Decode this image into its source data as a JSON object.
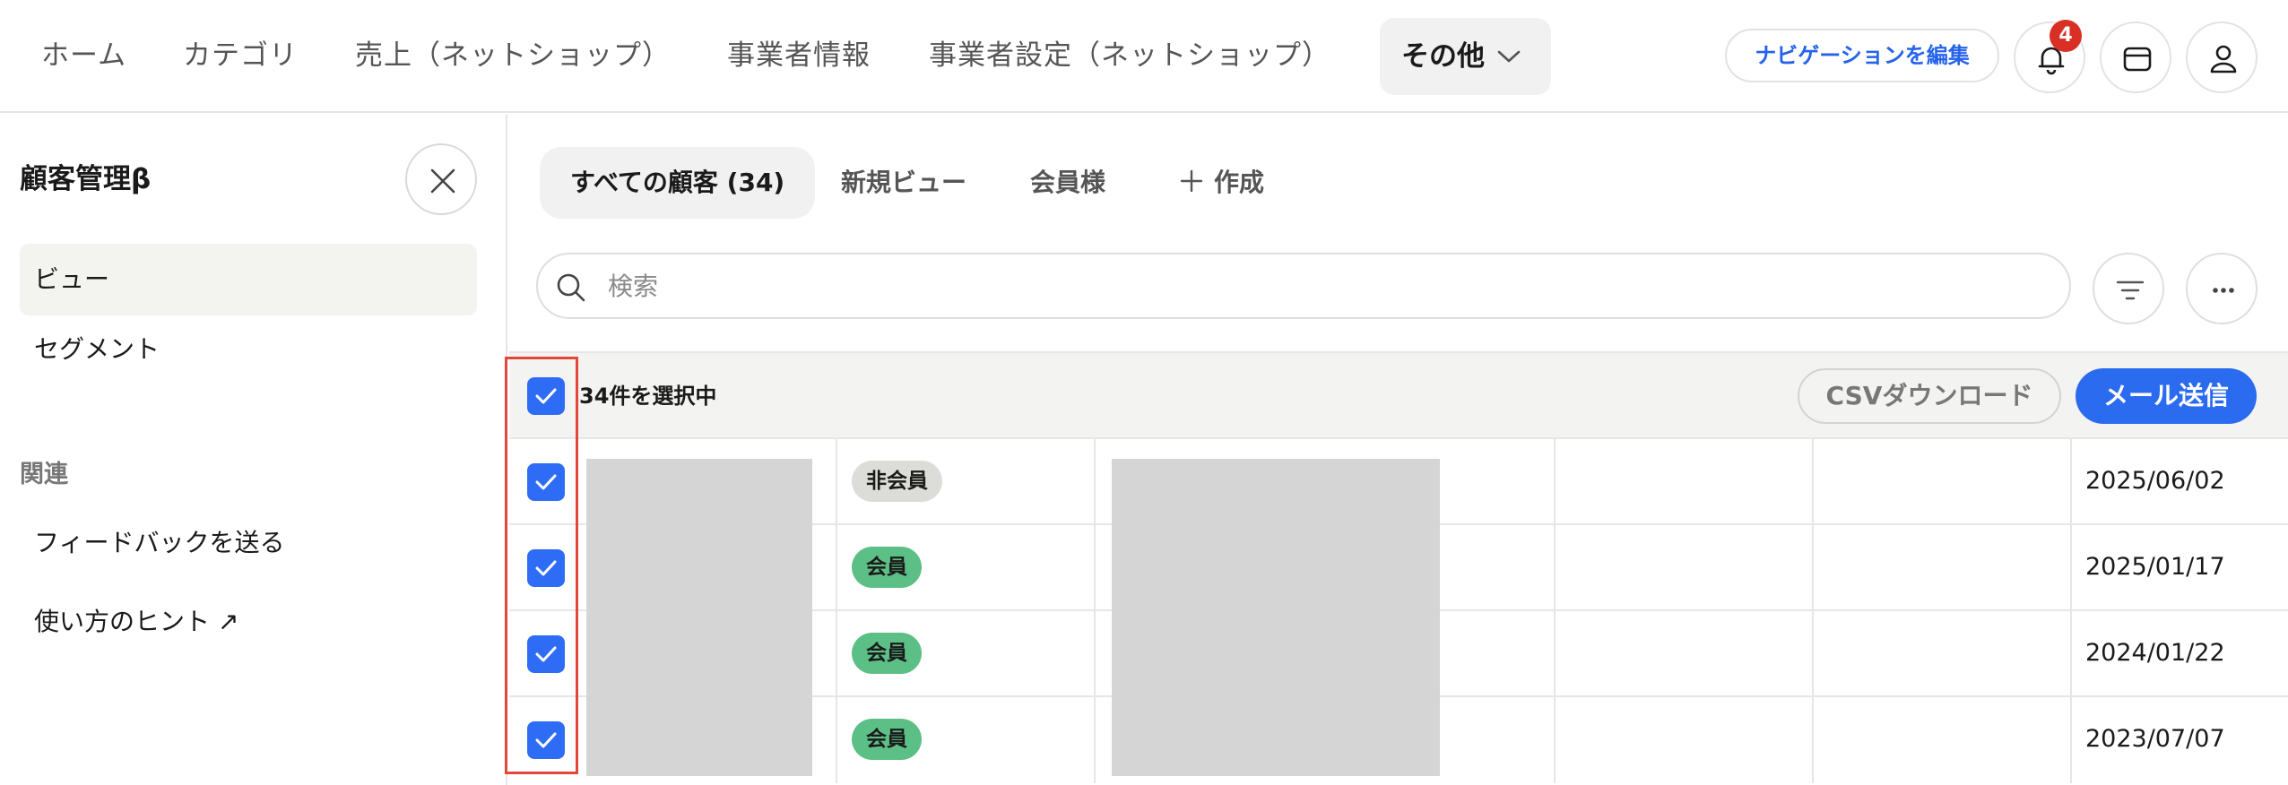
{
  "topnav": {
    "items": [
      "ホーム",
      "カテゴリ",
      "売上（ネットショップ）",
      "事業者情報",
      "事業者設定（ネットショップ）"
    ],
    "more_label": "その他",
    "edit_nav_label": "ナビゲーションを編集",
    "notification_count": "4"
  },
  "sidebar": {
    "title": "顧客管理β",
    "items": [
      "ビュー",
      "セグメント"
    ],
    "section_title": "関連",
    "links": [
      "フィードバックを送る",
      "使い方のヒント ↗"
    ]
  },
  "main": {
    "tabs": [
      "すべての顧客 (34)",
      "新規ビュー",
      "会員様"
    ],
    "create_label": "作成",
    "search_placeholder": "検索",
    "selection_text": "34件を選択中",
    "csv_label": "CSVダウンロード",
    "mail_label": "メール送信",
    "rows": [
      {
        "status": "非会員",
        "status_type": "non",
        "date": "2025/06/02"
      },
      {
        "status": "会員",
        "status_type": "mem",
        "date": "2025/01/17"
      },
      {
        "status": "会員",
        "status_type": "mem",
        "date": "2024/01/22"
      },
      {
        "status": "会員",
        "status_type": "mem",
        "date": "2023/07/07"
      }
    ]
  },
  "colors": {
    "accent": "#2b6bf0",
    "member_badge": "#5cbf86",
    "nonmember_badge": "#dcdcd8",
    "notification_badge": "#d93025",
    "highlight_box": "#e0483a"
  }
}
